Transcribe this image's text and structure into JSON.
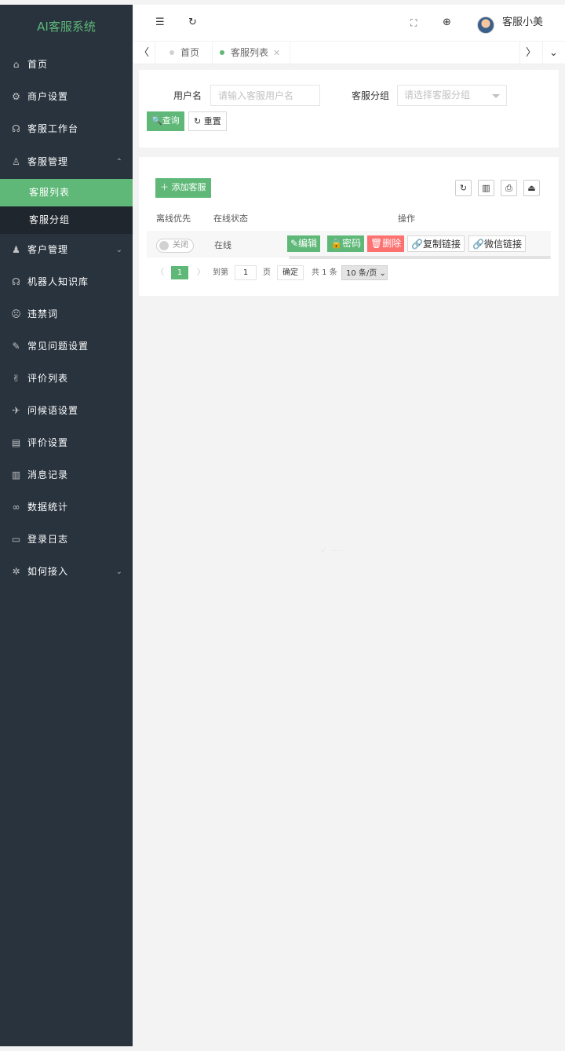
{
  "sidebar": {
    "title": "AI客服系统",
    "items": [
      {
        "label": "首页",
        "icon": "⌂"
      },
      {
        "label": "商户设置",
        "icon": "⚙"
      },
      {
        "label": "客服工作台",
        "icon": "☊"
      },
      {
        "label": "客服管理",
        "icon": "♙",
        "arrow": "⌃"
      },
      {
        "label": "客户管理",
        "icon": "♟",
        "arrow": "⌄"
      },
      {
        "label": "机器人知识库",
        "icon": "☊"
      },
      {
        "label": "违禁词",
        "icon": "☹"
      },
      {
        "label": "常见问题设置",
        "icon": "✎"
      },
      {
        "label": "评价列表",
        "icon": "✌"
      },
      {
        "label": "问候语设置",
        "icon": "✈"
      },
      {
        "label": "评价设置",
        "icon": "▤"
      },
      {
        "label": "消息记录",
        "icon": "▥"
      },
      {
        "label": "数据统计",
        "icon": "∞"
      },
      {
        "label": "登录日志",
        "icon": "▭"
      },
      {
        "label": "如何接入",
        "icon": "✲",
        "arrow": "⌄"
      }
    ],
    "subitems": [
      {
        "label": "客服列表"
      },
      {
        "label": "客服分组"
      }
    ]
  },
  "header": {
    "menu_icon": "☰",
    "refresh_icon": "↻",
    "fullscreen_icon": "⛶",
    "lang_icon": "⊕",
    "username": "客服小美"
  },
  "tabs": {
    "prev": "〈",
    "next": "〉",
    "more": "⌄",
    "items": [
      {
        "label": "首页"
      },
      {
        "label": "客服列表",
        "close": "✕"
      }
    ]
  },
  "search": {
    "username_label": "用户名",
    "username_placeholder": "请输入客服用户名",
    "group_label": "客服分组",
    "group_placeholder": "请选择客服分组",
    "query_label": "🔍查询",
    "reset_label": "↻ 重置"
  },
  "table": {
    "add_label": "＋ 添加客服",
    "tools": {
      "refresh": "↻",
      "columns": "▥",
      "print": "⎙",
      "export": "⏏"
    },
    "headers": {
      "offline_first": "离线优先",
      "status": "在线状态",
      "actions": "操作"
    },
    "row": {
      "switch_label": "关闭",
      "status": "在线"
    },
    "actions": {
      "edit": "✎编辑",
      "password": "🔒密码",
      "delete": "🗑删除",
      "copy_link": "🔗复制链接",
      "wechat_link": "🔗微信链接"
    }
  },
  "pager": {
    "prev": "〈",
    "current": "1",
    "next": "〉",
    "goto": "到第",
    "goto_value": "1",
    "page_unit": "页",
    "confirm": "确定",
    "total": "共 1 条",
    "size": "10 条/页 ⌄"
  },
  "colors": {
    "accent": "#5fb878",
    "sidebar_bg": "#28333e",
    "danger": "#ff5a5a"
  }
}
